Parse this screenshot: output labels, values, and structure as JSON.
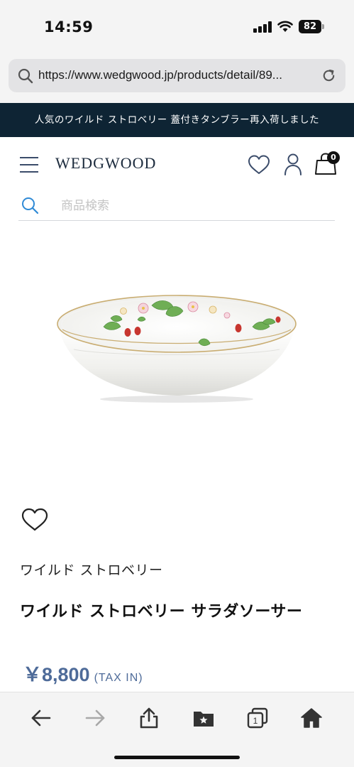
{
  "status_bar": {
    "time": "14:59",
    "battery_level": "82"
  },
  "browser": {
    "url": "https://www.wedgwood.jp/products/detail/89...",
    "toolbar": {
      "back_icon": "arrow-left-icon",
      "forward_icon": "arrow-right-icon",
      "share_icon": "share-icon",
      "bookmarks_icon": "bookmark-folder-icon",
      "tabs_count": "1",
      "home_icon": "home-icon"
    }
  },
  "announcement": "人気のワイルド ストロベリー 蓋付きタンブラー再入荷しました",
  "header": {
    "logo": "WEDGWOOD",
    "cart_count": "0"
  },
  "search": {
    "placeholder": "商品検索"
  },
  "product": {
    "collection": "ワイルド ストロベリー",
    "title": "ワイルド ストロベリー サラダソーサー",
    "price": "￥8,800",
    "tax_label": "(TAX IN)"
  },
  "colors": {
    "announcement_bg": "#0e2434",
    "price": "#4e6b99",
    "accent_icons": "#3b4c6a"
  }
}
